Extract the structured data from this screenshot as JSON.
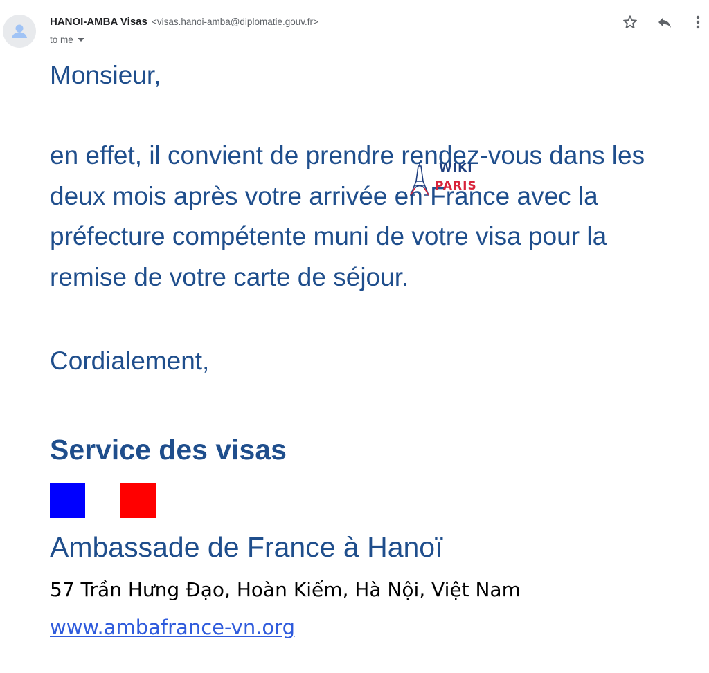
{
  "header": {
    "sender_name": "HANOI-AMBA Visas",
    "sender_email": "<visas.hanoi-amba@diplomatie.gouv.fr>",
    "recipient_label": "to me",
    "icons": [
      "star-icon",
      "reply-icon",
      "more-vert-icon"
    ]
  },
  "message": {
    "greeting": "Monsieur,",
    "paragraph_lines": [
      "en effet, il convient de prendre rendez-vous dans les",
      "deux mois après votre arrivée en France avec la",
      "préfecture compétente muni de votre visa pour la",
      "remise de votre carte de séjour."
    ],
    "closing": "Cordialement,"
  },
  "signature": {
    "service": "Service des visas",
    "flag_colors": {
      "blue": "#0000ff",
      "white": "#ffffff",
      "red": "#ff0000"
    },
    "embassy": "Ambassade de France à Hanoï",
    "address": "57 Trần Hưng Đạo, Hoàn Kiếm, Hà Nội, Việt Nam",
    "website": "www.ambafrance-vn.org"
  },
  "watermark": {
    "line1": "WIKI",
    "line2": "PARIS"
  },
  "colors": {
    "text_blue": "#1f4e8c",
    "link_blue": "#2f5bdc"
  }
}
